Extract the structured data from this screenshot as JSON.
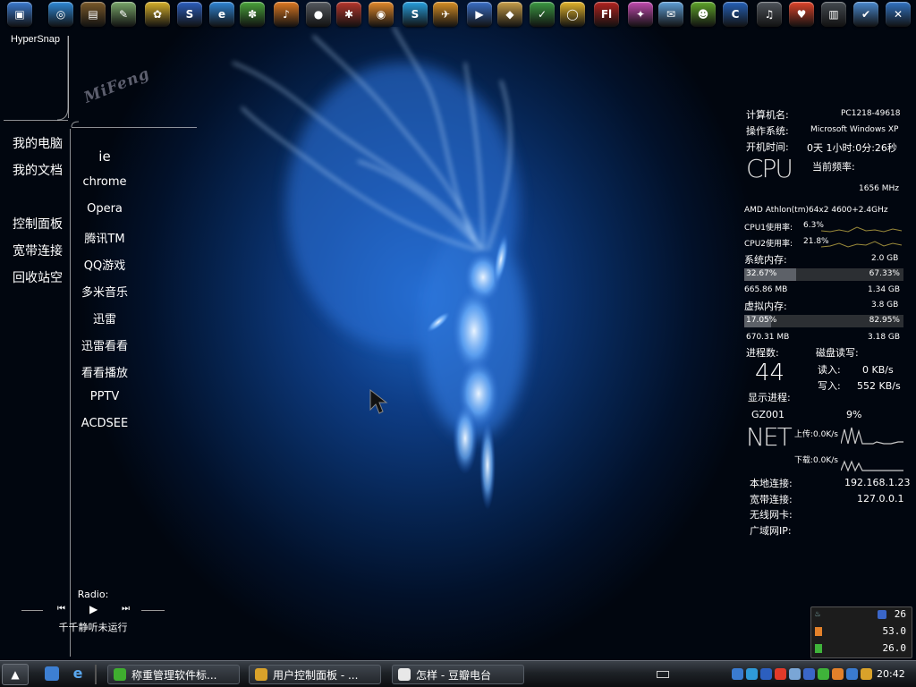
{
  "dock": {
    "icons": [
      {
        "name": "my-computer-icon",
        "color": "#3c7bd1",
        "glyph": "▣"
      },
      {
        "name": "network-icon",
        "color": "#2f8ad8",
        "glyph": "◎"
      },
      {
        "name": "winrar-icon",
        "color": "#7b5a2a",
        "glyph": "▤"
      },
      {
        "name": "image-viewer-icon",
        "color": "#7aa86a",
        "glyph": "✎"
      },
      {
        "name": "qq-pet-icon",
        "color": "#d8b12a",
        "glyph": "✿"
      },
      {
        "name": "sogou-icon",
        "color": "#2c5fbf",
        "glyph": "S"
      },
      {
        "name": "internet-explorer-icon",
        "color": "#2f86d6",
        "glyph": "e"
      },
      {
        "name": "flower-icon",
        "color": "#4aa53b",
        "glyph": "✽"
      },
      {
        "name": "fl-studio-icon",
        "color": "#e07a22",
        "glyph": "♪"
      },
      {
        "name": "sphere-icon",
        "color": "#555a60",
        "glyph": "●"
      },
      {
        "name": "bittorrent-icon",
        "color": "#b8362c",
        "glyph": "✱"
      },
      {
        "name": "blender-icon",
        "color": "#e58a2b",
        "glyph": "◉"
      },
      {
        "name": "skype-icon",
        "color": "#27a0e0",
        "glyph": "S"
      },
      {
        "name": "bird-icon",
        "color": "#d99025",
        "glyph": "✈"
      },
      {
        "name": "media-player-icon",
        "color": "#3a6fc8",
        "glyph": "▶"
      },
      {
        "name": "folder-game-icon",
        "color": "#c9a04a",
        "glyph": "◆"
      },
      {
        "name": "excel-icon",
        "color": "#3c9a43",
        "glyph": "✓"
      },
      {
        "name": "qq-game-icon",
        "color": "#e3b52c",
        "glyph": "◯"
      },
      {
        "name": "flash-icon",
        "color": "#b3231f",
        "glyph": "Fl"
      },
      {
        "name": "puzzle-icon",
        "color": "#c24ab0",
        "glyph": "✦"
      },
      {
        "name": "mail-icon",
        "color": "#5fa0d8",
        "glyph": "✉"
      },
      {
        "name": "alien-icon",
        "color": "#5fa62a",
        "glyph": "☻"
      },
      {
        "name": "care-icon",
        "color": "#2561b9",
        "glyph": "C"
      },
      {
        "name": "speaker-icon",
        "color": "#50555c",
        "glyph": "♫"
      },
      {
        "name": "heart-icon",
        "color": "#e0442a",
        "glyph": "♥"
      },
      {
        "name": "trash-icon",
        "color": "#444a50",
        "glyph": "▥"
      },
      {
        "name": "check-icon",
        "color": "#4a8ad0",
        "glyph": "✔"
      },
      {
        "name": "tool-icon",
        "color": "#3274c4",
        "glyph": "✕"
      }
    ]
  },
  "hypersnap": "HyperSnap",
  "logo_text": "MiFeng",
  "left_menu": [
    "我的电脑",
    "我的文档",
    "控制面板",
    "宽带连接",
    "回收站空"
  ],
  "programs": [
    "ie",
    "chrome",
    "Opera",
    "腾讯TM",
    "QQ游戏",
    "多米音乐",
    "迅雷",
    "迅雷看看",
    "看看播放",
    "PPTV",
    "ACDSEE"
  ],
  "monitor": {
    "computer_name_label": "计算机名:",
    "computer_name": "PC1218-49618",
    "os_label": "操作系统:",
    "os": "Microsoft Windows XP",
    "uptime_label": "开机时间:",
    "uptime": "0天 1小时:0分:26秒",
    "cpu_big": "CPU",
    "freq_label": "当前频率:",
    "freq": "1656 MHz",
    "cpu_model": "AMD Athlon(tm)64x2 4600+2.4GHz",
    "cpu1_label": "CPU1使用率:",
    "cpu1": "6.3%",
    "cpu2_label": "CPU2使用率:",
    "cpu2": "21.8%",
    "mem_label": "系统内存:",
    "mem_total": "2.0 GB",
    "mem_used_pct": "32.67%",
    "mem_free_pct": "67.33%",
    "mem_used_fraction": 0.3267,
    "mem_used": "665.86 MB",
    "mem_free": "1.34 GB",
    "vmem_label": "虚拟内存:",
    "vmem_total": "3.8 GB",
    "vmem_used_pct": "17.05%",
    "vmem_free_pct": "82.95%",
    "vmem_used_fraction": 0.1705,
    "vmem_used": "670.31 MB",
    "vmem_free": "3.18 GB",
    "proc_label": "进程数:",
    "proc_count": "44",
    "disk_label": "磁盘读写:",
    "read_label": "读入:",
    "read_val": "0 KB/s",
    "write_label": "写入:",
    "write_val": "552 KB/s",
    "show_proc_label": "显示进程:",
    "proc_name": "GZ001",
    "proc_pct": "9%",
    "net_big": "NET",
    "upload": "上传:0.0K/s",
    "download": "下载:0.0K/s",
    "local_label": "本地连接:",
    "local_ip": "192.168.1.23",
    "broadband_label": "宽带连接:",
    "broadband_ip": "127.0.0.1",
    "wireless_label": "无线网卡:",
    "wan_label": "广域网IP:"
  },
  "radio": {
    "label": "Radio:",
    "status": "千千静听未运行"
  },
  "meter": {
    "val1": "26",
    "val2": "53.0",
    "val3": "26.0"
  },
  "taskbar": {
    "tasks": [
      {
        "label": "称重管理软件标...",
        "icon_color": "#3fae2f"
      },
      {
        "label": "用户控制面板 - ...",
        "icon_color": "#d9a22a"
      },
      {
        "label": "怎样 - 豆瓣电台",
        "icon_color": "#e8e8e8"
      }
    ],
    "clock": "20:42"
  }
}
